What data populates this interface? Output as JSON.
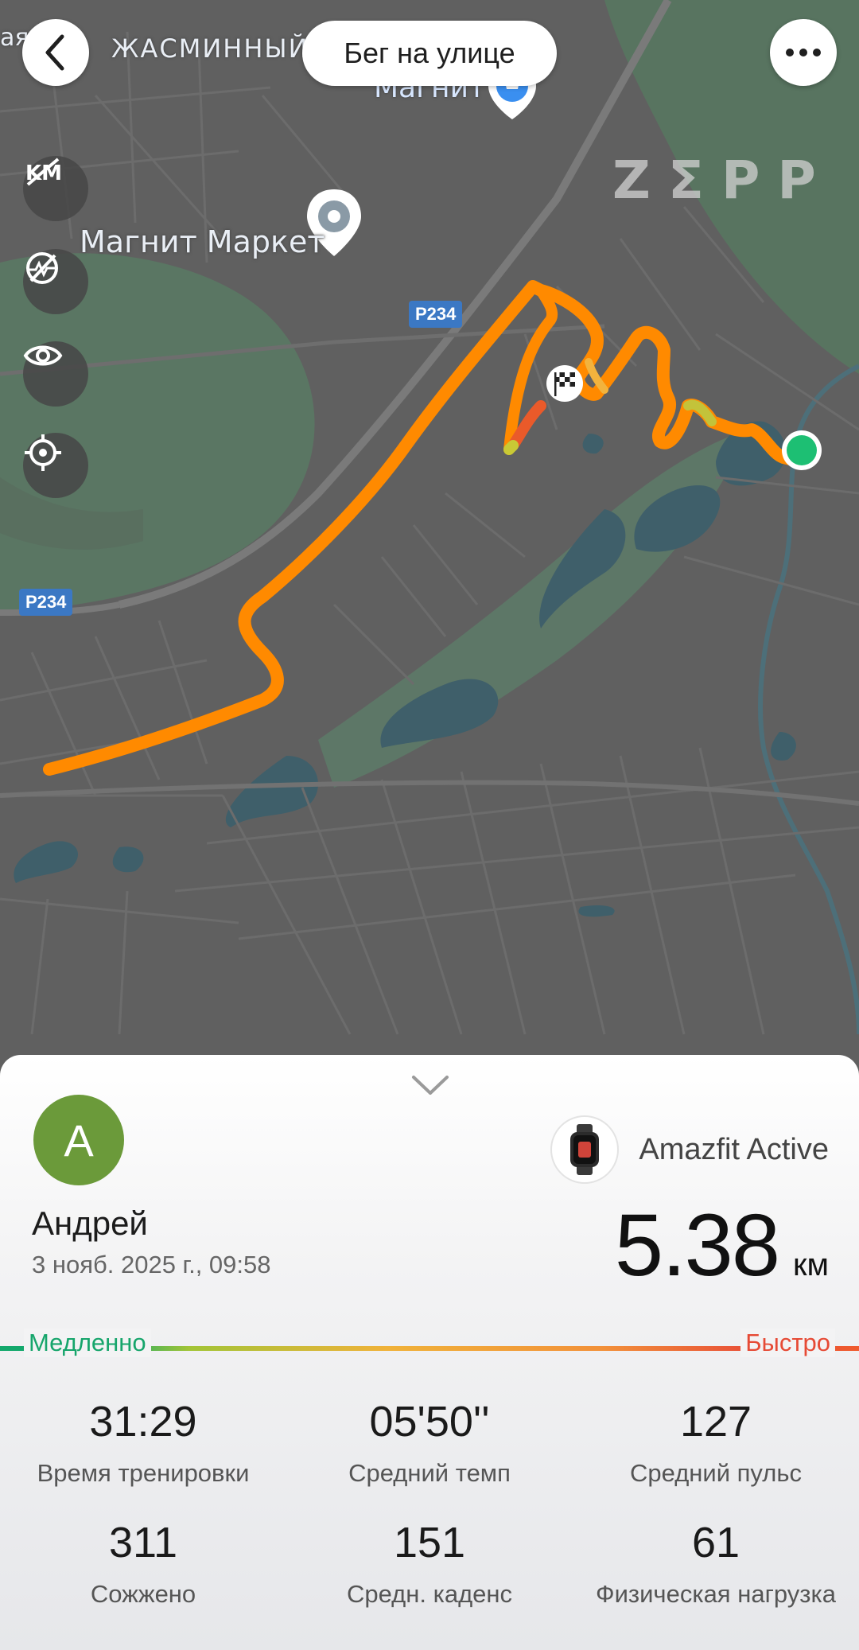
{
  "header": {
    "title": "Бег на улице",
    "back_icon": "chevron-left-icon",
    "more_icon": "more-horizontal-icon"
  },
  "map": {
    "brand": "ZΣPP",
    "labels": {
      "district_partial_left": "ая",
      "district": "ЖАСМИННЫЙ",
      "shop_top": "Магнит",
      "shop_market": "Магнит Маркет",
      "road_badge_1": "Р234",
      "road_badge_2": "Р234"
    },
    "side_buttons": [
      {
        "icon": "km-markers-off-icon"
      },
      {
        "icon": "heart-rate-off-icon"
      },
      {
        "icon": "eye-icon"
      },
      {
        "icon": "locate-icon"
      }
    ],
    "colors": {
      "route": "#ff8c00",
      "route_highlight": "#f5a623",
      "start_marker": "#1dbf73",
      "water": "#3f5f6a",
      "park": "#5b7a64",
      "base": "#5f5f5f"
    }
  },
  "summary": {
    "user_name": "Андрей",
    "avatar_letter": "A",
    "datetime": "3 нояб. 2025 г., 09:58",
    "device": "Amazfit Active",
    "distance": "5.38",
    "distance_unit": "км",
    "pace_scale": {
      "slow_label": "Медленно",
      "fast_label": "Быстро"
    },
    "stats": [
      {
        "value": "31:29",
        "label": "Время тренировки"
      },
      {
        "value": "05'50''",
        "label": "Средний темп"
      },
      {
        "value": "127",
        "label": "Средний пульс"
      },
      {
        "value": "311",
        "label": "Сожжено"
      },
      {
        "value": "151",
        "label": "Средн. каденс"
      },
      {
        "value": "61",
        "label": "Физическая нагрузка"
      }
    ]
  }
}
